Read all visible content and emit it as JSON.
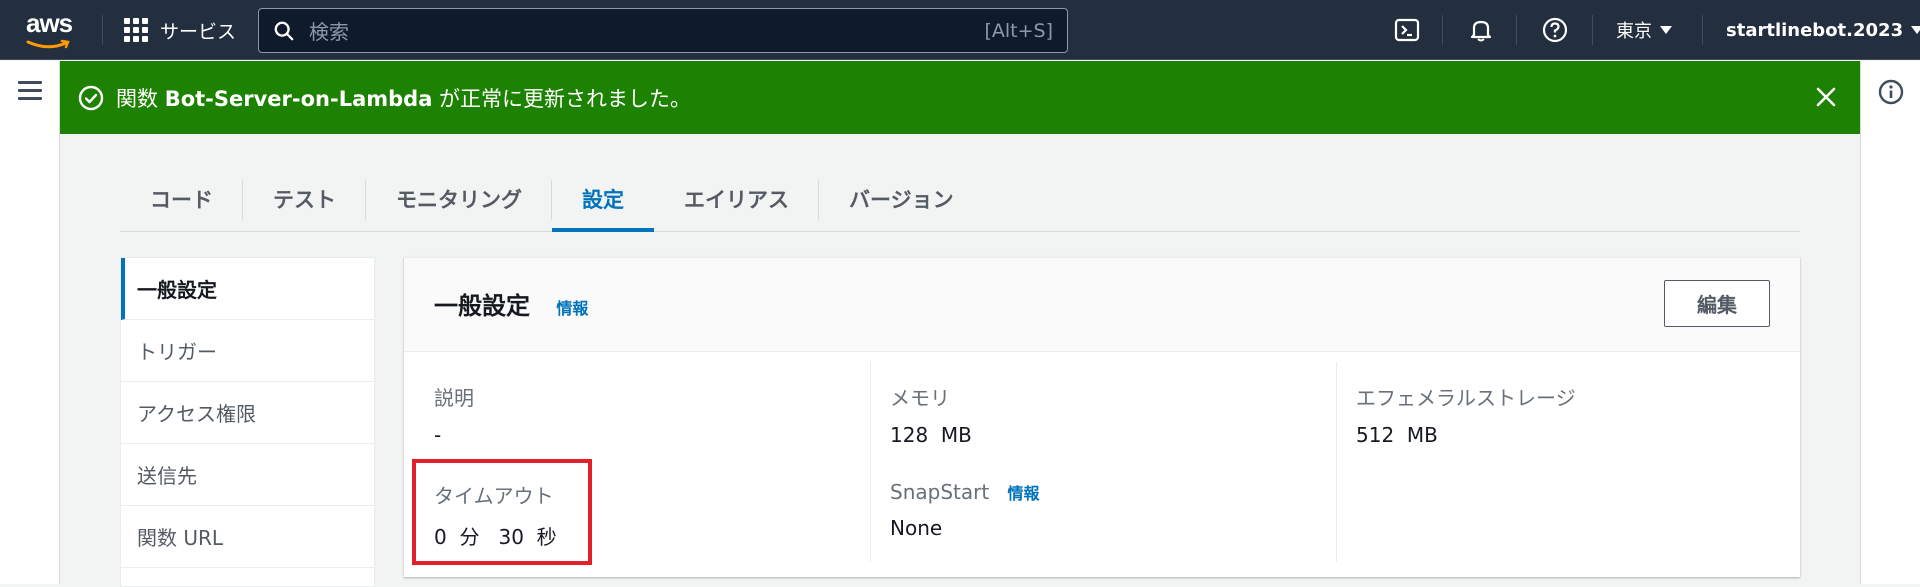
{
  "topnav": {
    "logo_text": "aws",
    "services_label": "サービス",
    "search_placeholder": "検索",
    "search_shortcut": "[Alt+S]",
    "region": "東京",
    "account": "startlinebot.2023"
  },
  "flash": {
    "prefix": "関数 ",
    "function_name": "Bot-Server-on-Lambda",
    "suffix": " が正常に更新されました。"
  },
  "tabs": [
    {
      "label": "コード"
    },
    {
      "label": "テスト"
    },
    {
      "label": "モニタリング"
    },
    {
      "label": "設定"
    },
    {
      "label": "エイリアス"
    },
    {
      "label": "バージョン"
    }
  ],
  "sidenav": [
    {
      "label": "一般設定"
    },
    {
      "label": "トリガー"
    },
    {
      "label": "アクセス権限"
    },
    {
      "label": "送信先"
    },
    {
      "label": "関数 URL"
    }
  ],
  "panel": {
    "title": "一般設定",
    "info": "情報",
    "edit_label": "編集",
    "fields": {
      "description": {
        "label": "説明",
        "value": "-"
      },
      "memory": {
        "label": "メモリ",
        "value": "128  MB"
      },
      "ephemeral": {
        "label": "エフェメラルストレージ",
        "value": "512  MB"
      },
      "timeout": {
        "label": "タイムアウト",
        "value": "0  分   30  秒"
      },
      "snapstart": {
        "label": "SnapStart",
        "info": "情報",
        "value": "None"
      }
    }
  },
  "colors": {
    "nav_bg": "#232f3e",
    "success": "#1d8102",
    "accent": "#0073bb",
    "highlight": "#e0202a"
  }
}
